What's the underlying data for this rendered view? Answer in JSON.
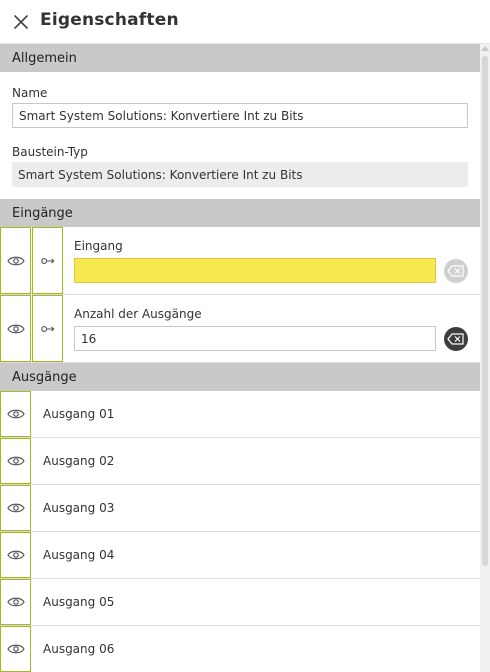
{
  "panel": {
    "title": "Eigenschaften",
    "close_icon": "close-icon"
  },
  "colors": {
    "accent_border": "#a7b81e",
    "section_bg": "#c9c9c9",
    "highlight_input": "#f7e94f",
    "clear_disabled": "#cfcfcf",
    "clear_active": "#3d3d3d"
  },
  "general": {
    "section_label": "Allgemein",
    "name_label": "Name",
    "name_value": "Smart System Solutions: Konvertiere Int zu Bits",
    "type_label": "Baustein-Typ",
    "type_value": "Smart System Solutions: Konvertiere Int zu Bits"
  },
  "inputs": {
    "section_label": "Eingänge",
    "items": [
      {
        "label": "Eingang",
        "value": "",
        "highlighted": true,
        "clear_enabled": false,
        "icons": [
          "eye-icon",
          "connect-icon",
          "clear-icon"
        ]
      },
      {
        "label": "Anzahl der Ausgänge",
        "value": "16",
        "highlighted": false,
        "clear_enabled": true,
        "icons": [
          "eye-icon",
          "connect-icon",
          "clear-icon"
        ]
      }
    ]
  },
  "outputs": {
    "section_label": "Ausgänge",
    "items": [
      {
        "label": "Ausgang 01",
        "icon": "eye-icon"
      },
      {
        "label": "Ausgang 02",
        "icon": "eye-icon"
      },
      {
        "label": "Ausgang 03",
        "icon": "eye-icon"
      },
      {
        "label": "Ausgang 04",
        "icon": "eye-icon"
      },
      {
        "label": "Ausgang 05",
        "icon": "eye-icon"
      },
      {
        "label": "Ausgang 06",
        "icon": "eye-icon"
      }
    ]
  }
}
